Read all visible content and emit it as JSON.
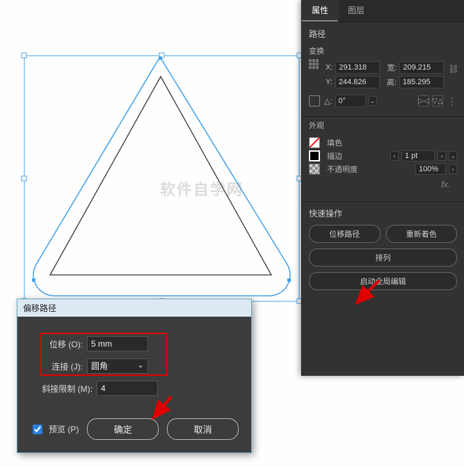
{
  "watermark": "软件自学网",
  "props": {
    "tabs": {
      "properties": "属性",
      "layers": "图层"
    },
    "path_label": "路径",
    "transform": {
      "header": "变换",
      "x_label": "X:",
      "x": "291.318",
      "y_label": "Y:",
      "y": "244.826",
      "w_label": "宽:",
      "w": "209.215",
      "h_label": "高:",
      "h": "185.295",
      "angle_label": "△:",
      "angle": "0°",
      "flip_h": "⇋",
      "flip_v": "⥯",
      "dots": "⋮"
    },
    "appearance": {
      "header": "外观",
      "fill_label": "填色",
      "stroke_label": "描边",
      "stroke_weight": "1 pt",
      "opacity_label": "不透明度",
      "opacity": "100%",
      "fx_label": "fx."
    },
    "quick": {
      "header": "快速操作",
      "offset_path": "位移路径",
      "recolor": "重新着色",
      "arrange": "排列",
      "global_edit": "启动全局编辑"
    }
  },
  "dialog": {
    "title": "偏移路径",
    "offset_label": "位移 (O):",
    "offset_value": "5 mm",
    "join_label": "连接 (J):",
    "join_value": "圆角",
    "miter_label": "斜接限制 (M):",
    "miter_value": "4",
    "preview_label": "预览 (P)",
    "ok": "确定",
    "cancel": "取消"
  }
}
